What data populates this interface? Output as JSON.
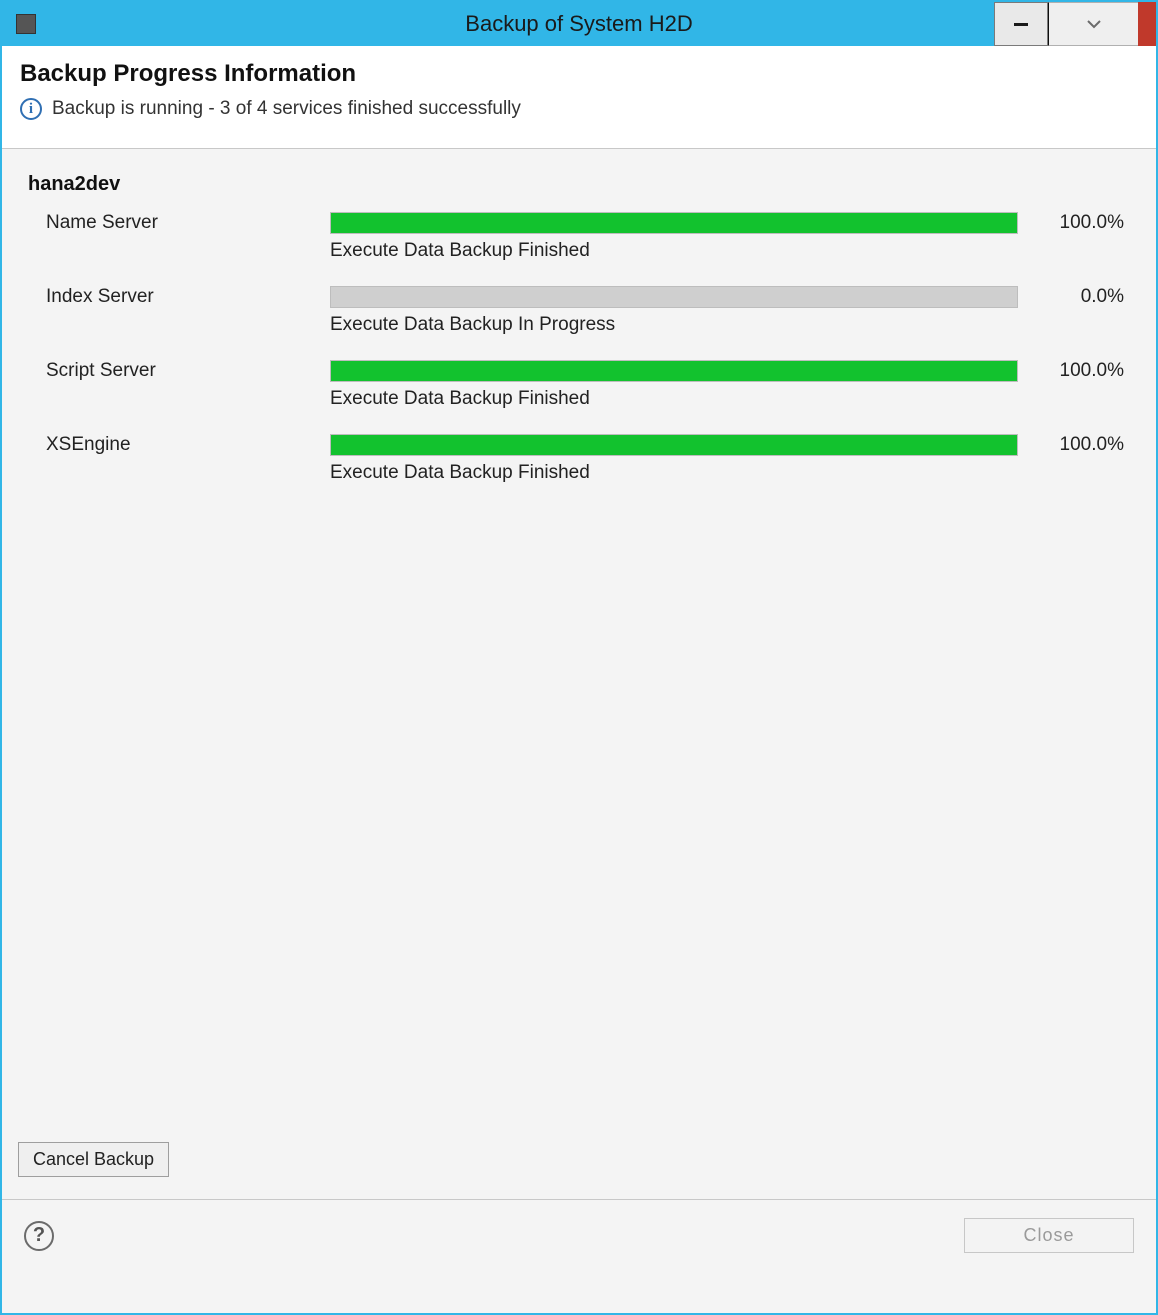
{
  "window": {
    "title": "Backup of System H2D"
  },
  "header": {
    "heading": "Backup Progress Information",
    "status": "Backup is running - 3 of 4 services finished successfully"
  },
  "host": "hana2dev",
  "services": [
    {
      "name": "Name Server",
      "percent": 100.0,
      "percent_label": "100.0%",
      "status": "Execute Data Backup Finished",
      "color": "#12c22e"
    },
    {
      "name": "Index Server",
      "percent": 0.0,
      "percent_label": "0.0%",
      "status": "Execute Data Backup In Progress",
      "color": "#cfcfcf"
    },
    {
      "name": "Script Server",
      "percent": 100.0,
      "percent_label": "100.0%",
      "status": "Execute Data Backup Finished",
      "color": "#12c22e"
    },
    {
      "name": "XSEngine",
      "percent": 100.0,
      "percent_label": "100.0%",
      "status": "Execute Data Backup Finished",
      "color": "#12c22e"
    }
  ],
  "buttons": {
    "cancel": "Cancel Backup",
    "close": "Close"
  }
}
